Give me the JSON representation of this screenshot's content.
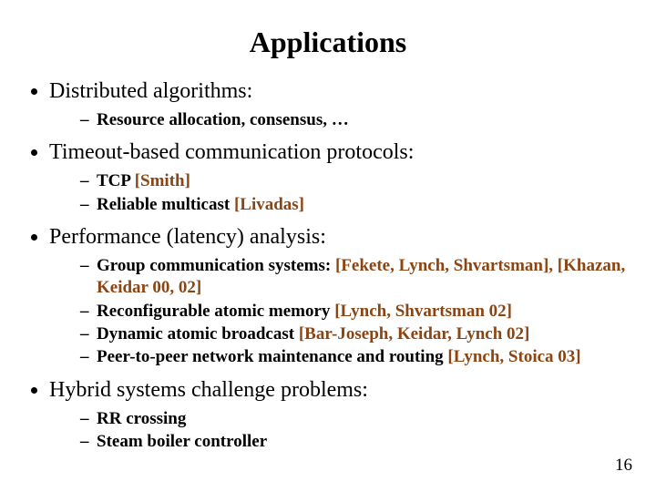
{
  "title": "Applications",
  "page_number": "16",
  "citation_color": "#8b4513",
  "bullets": {
    "b1": {
      "heading": "Distributed algorithms:",
      "s1": "Resource allocation, consensus, …"
    },
    "b2": {
      "heading": "Timeout-based communication protocols:",
      "s1_pre": "TCP ",
      "s1_cite": "[Smith]",
      "s2_pre": "Reliable multicast ",
      "s2_cite": "[Livadas]"
    },
    "b3": {
      "heading": "Performance (latency) analysis:",
      "s1_pre": "Group communication systems: ",
      "s1_cite": "[Fekete, Lynch, Shvartsman], [Khazan, Keidar 00, 02]",
      "s2_pre": "Reconfigurable atomic memory ",
      "s2_cite": "[Lynch, Shvartsman 02]",
      "s3_pre": "Dynamic atomic broadcast ",
      "s3_cite": "[Bar-Joseph, Keidar, Lynch 02]",
      "s4_pre": "Peer-to-peer network maintenance and routing ",
      "s4_cite": "[Lynch, Stoica 03]"
    },
    "b4": {
      "heading": "Hybrid systems challenge problems:",
      "s1": "RR crossing",
      "s2": "Steam boiler controller"
    }
  }
}
